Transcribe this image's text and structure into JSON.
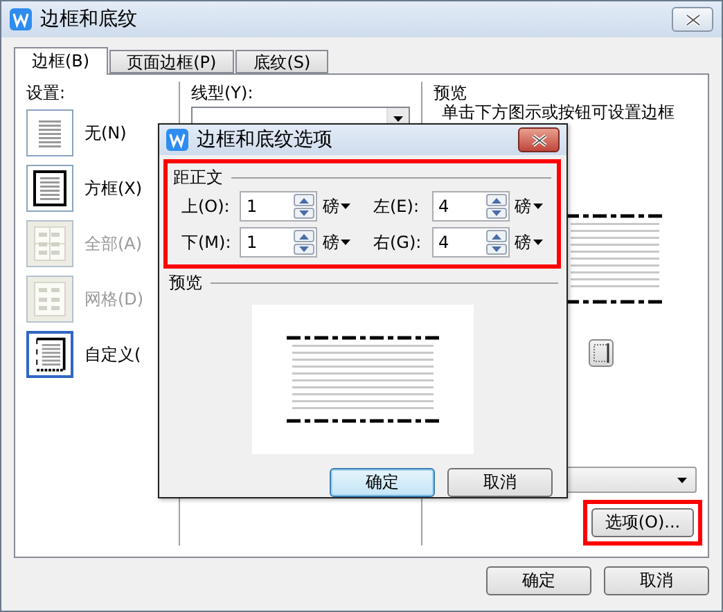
{
  "window": {
    "title": "边框和底纹"
  },
  "tabs": [
    {
      "label": "边框(B)",
      "selected": true
    },
    {
      "label": "页面边框(P)",
      "selected": false
    },
    {
      "label": "底纹(S)",
      "selected": false
    }
  ],
  "settings": {
    "label": "设置:",
    "items": [
      {
        "kind": "none",
        "label": "无(N)",
        "disabled": false,
        "selected": false
      },
      {
        "kind": "box",
        "label": "方框(X)",
        "disabled": false,
        "selected": false
      },
      {
        "kind": "all",
        "label": "全部(A)",
        "disabled": true,
        "selected": false
      },
      {
        "kind": "grid",
        "label": "网格(D)",
        "disabled": true,
        "selected": false
      },
      {
        "kind": "custom",
        "label": "自定义(",
        "disabled": false,
        "selected": true
      }
    ]
  },
  "line_style": {
    "label": "线型(Y):"
  },
  "preview": {
    "title": "预览",
    "hint": "单击下方图示或按钮可设置边框"
  },
  "options_button": {
    "label": "选项(O)...",
    "highlighted": true
  },
  "buttons": [
    {
      "label": "确定"
    },
    {
      "label": "取消"
    }
  ],
  "options_dialog": {
    "title": "边框和底纹选项",
    "group": {
      "label": "距正文",
      "highlighted": true,
      "fields": [
        {
          "label": "上(O):",
          "value": "1",
          "unit": "磅"
        },
        {
          "label": "左(E):",
          "value": "4",
          "unit": "磅"
        },
        {
          "label": "下(M):",
          "value": "1",
          "unit": "磅"
        },
        {
          "label": "右(G):",
          "value": "4",
          "unit": "磅"
        }
      ]
    },
    "preview_label": "预览",
    "buttons": [
      {
        "label": "确定",
        "default": true
      },
      {
        "label": "取消",
        "default": false
      }
    ]
  }
}
